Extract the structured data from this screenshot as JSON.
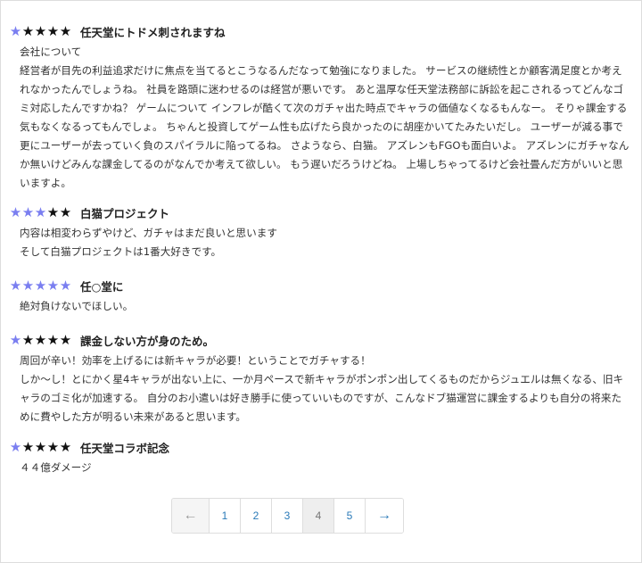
{
  "colors": {
    "star_filled": "#7a7ef0",
    "star_empty": "#111111",
    "link": "#2a7ab8"
  },
  "star_glyph": "★",
  "reviews": [
    {
      "rating": 1,
      "max": 5,
      "title": "任天堂にトドメ刺されますね",
      "lines": [
        "会社について",
        "経営者が目先の利益追求だけに焦点を当てるとこうなるんだなって勉強になりました。 サービスの継続性とか顧客満足度とか考えれなかったんでしょうね。 社員を路頭に迷わせるのは経営が悪いです。 あと温厚な任天堂法務部に訴訟を起こされるってどんなゴミ対応したんですかね？ ゲームについて インフレが酷くて次のガチャ出た時点でキャラの価値なくなるもんなー。 そりゃ課金する気もなくなるってもんでしょ。 ちゃんと投資してゲーム性も広げたら良かったのに胡座かいてたみたいだし。 ユーザーが減る事で更にユーザーが去っていく負のスパイラルに陥ってるね。 さようなら、白猫。 アズレンもFGOも面白いよ。 アズレンにガチャなんか無いけどみんな課金してるのがなんでか考えて欲しい。 もう遅いだろうけどね。 上場しちゃってるけど会社畳んだ方がいいと思いますよ。"
      ]
    },
    {
      "rating": 3,
      "max": 5,
      "title": "白猫プロジェクト",
      "lines": [
        "内容は相変わらずやけど、ガチャはまだ良いと思います",
        "そして白猫プロジェクトは1番大好きです。"
      ]
    },
    {
      "rating": 5,
      "max": 5,
      "title": "任○堂に",
      "lines": [
        "絶対負けないでほしい。"
      ]
    },
    {
      "rating": 1,
      "max": 5,
      "title": "課金しない方が身のため。",
      "lines": [
        "周回が辛い！効率を上げるには新キャラが必要！ということでガチャする！",
        "しか〜し！とにかく星4キャラが出ない上に、一か月ペースで新キャラがポンポン出してくるものだからジュエルは無くなる、旧キャラのゴミ化が加速する。 自分のお小遣いは好き勝手に使っていいものですが、こんなドブ猫運営に課金するよりも自分の将来ために費やした方が明るい未来があると思います。"
      ]
    },
    {
      "rating": 1,
      "max": 5,
      "title": "任天堂コラボ記念",
      "lines": [
        "４４億ダメージ"
      ]
    }
  ],
  "pagination": {
    "prev": "←",
    "pages": [
      "1",
      "2",
      "3",
      "4",
      "5"
    ],
    "current": "4",
    "next": "→"
  }
}
